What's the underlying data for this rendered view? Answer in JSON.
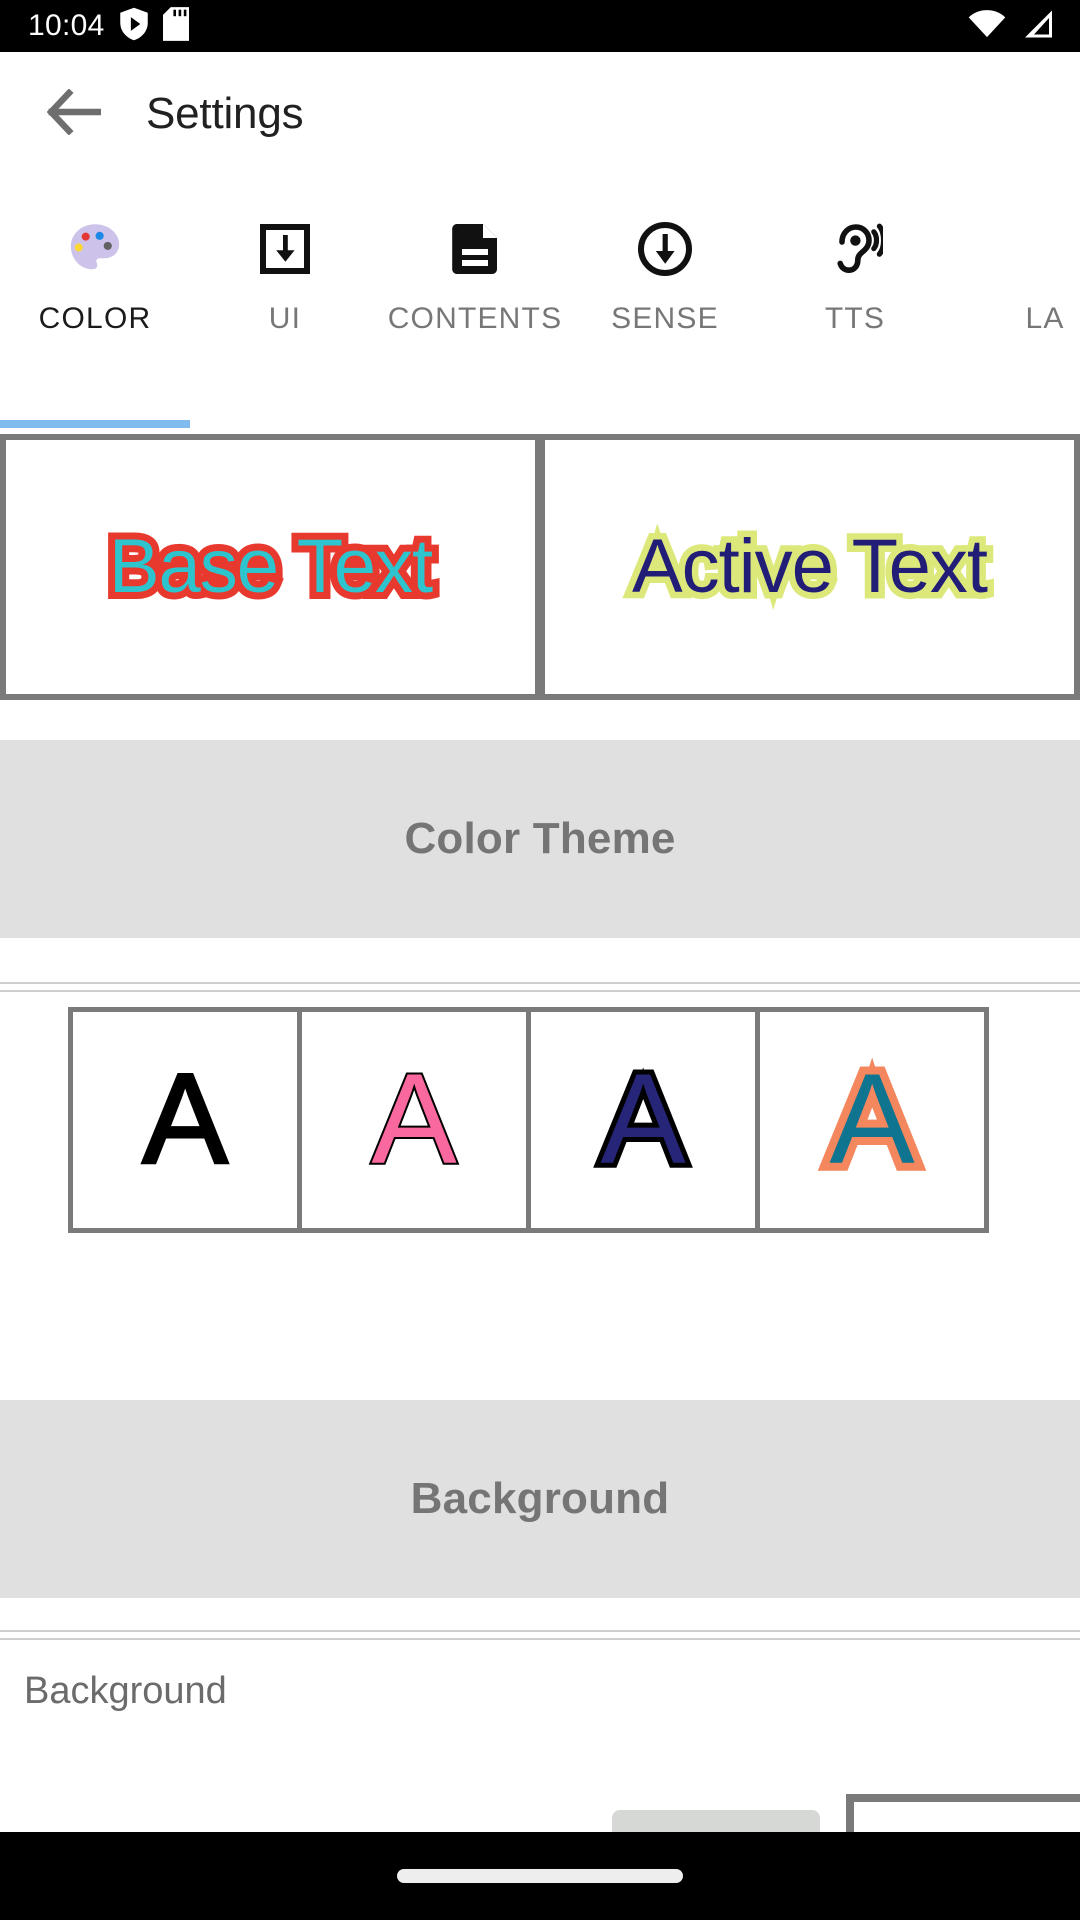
{
  "status_bar": {
    "clock": "10:04",
    "icons": [
      "play-protect-icon",
      "sd-card-icon",
      "wifi-icon",
      "cellular-signal-icon"
    ]
  },
  "app_bar": {
    "back_icon": "back-arrow-icon",
    "title": "Settings"
  },
  "tabs": {
    "active_index": 0,
    "items": [
      {
        "label": "COLOR",
        "icon": "palette-icon"
      },
      {
        "label": "UI",
        "icon": "import-box-icon"
      },
      {
        "label": "CONTENTS",
        "icon": "document-icon"
      },
      {
        "label": "SENSE",
        "icon": "circle-down-arrow-icon"
      },
      {
        "label": "TTS",
        "icon": "hearing-icon"
      },
      {
        "label": "LA",
        "icon": ""
      }
    ],
    "indicator_color": "#7fbbec"
  },
  "preview": {
    "base": {
      "text": "Base Text",
      "fill_color": "#2ec4cd",
      "stroke_color": "#e8392f"
    },
    "active": {
      "text": "Active Text",
      "fill_color": "#221e78",
      "stroke_color": "#dde87a"
    }
  },
  "sections": {
    "color_theme": {
      "title": "Color Theme",
      "themes": [
        {
          "glyph": "A",
          "fill_color": "#000000",
          "stroke_color": "#000000"
        },
        {
          "glyph": "A",
          "fill_color": "#f9699f",
          "stroke_color": "#000000"
        },
        {
          "glyph": "A",
          "fill_color": "#262577",
          "stroke_color": "#000000"
        },
        {
          "glyph": "A",
          "fill_color": "#0e7490",
          "stroke_color": "#f4875e"
        }
      ]
    },
    "background": {
      "title": "Background",
      "row_label": "Background",
      "swatch_gray_color": "#d6d8d6",
      "swatch_white_color": "#ffffff"
    }
  },
  "nav_bar": {
    "gesture_pill": "home-gesture-pill"
  }
}
